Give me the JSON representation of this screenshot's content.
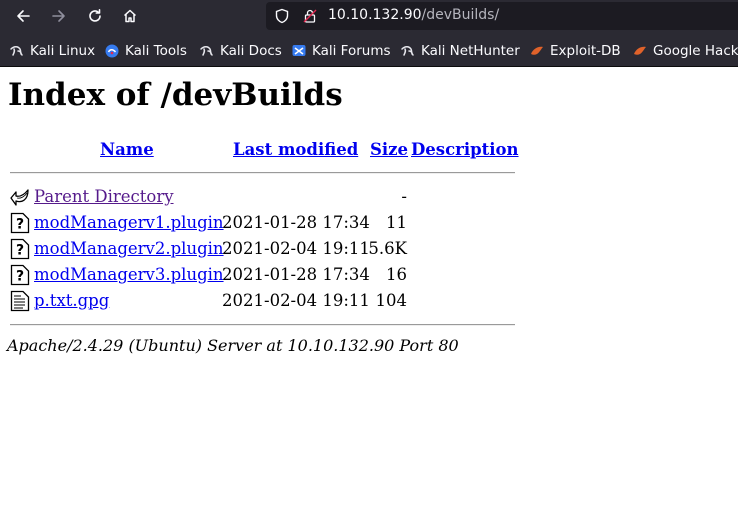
{
  "browser": {
    "url_host": "10.10.132.90",
    "url_path": "/devBuilds/",
    "bookmarks": [
      {
        "label": "Kali Linux",
        "icon": "kali-dragon-icon"
      },
      {
        "label": "Kali Tools",
        "icon": "kali-tools-icon"
      },
      {
        "label": "Kali Docs",
        "icon": "kali-dragon-icon"
      },
      {
        "label": "Kali Forums",
        "icon": "kali-forums-icon"
      },
      {
        "label": "Kali NetHunter",
        "icon": "kali-dragon-icon"
      },
      {
        "label": "Exploit-DB",
        "icon": "exploit-db-icon"
      },
      {
        "label": "Google Hacki",
        "icon": "exploit-db-icon"
      }
    ]
  },
  "page": {
    "title": "Index of /devBuilds",
    "columns": {
      "name": "Name",
      "last_modified": "Last modified",
      "size": "Size",
      "description": "Description"
    },
    "rows": [
      {
        "name": "Parent Directory",
        "date": "",
        "size": "-",
        "icon": "back-arrow-icon"
      },
      {
        "name": "modManagerv1.plugin",
        "date": "2021-01-28 17:34",
        "size": "11",
        "icon": "unknown-file-icon"
      },
      {
        "name": "modManagerv2.plugin",
        "date": "2021-02-04 19:11",
        "size": "5.6K",
        "icon": "unknown-file-icon"
      },
      {
        "name": "modManagerv3.plugin",
        "date": "2021-01-28 17:34",
        "size": "16",
        "icon": "unknown-file-icon"
      },
      {
        "name": "p.txt.gpg",
        "date": "2021-02-04 19:11",
        "size": "104",
        "icon": "text-file-icon"
      }
    ],
    "footer": "Apache/2.4.29 (Ubuntu) Server at 10.10.132.90 Port 80"
  }
}
